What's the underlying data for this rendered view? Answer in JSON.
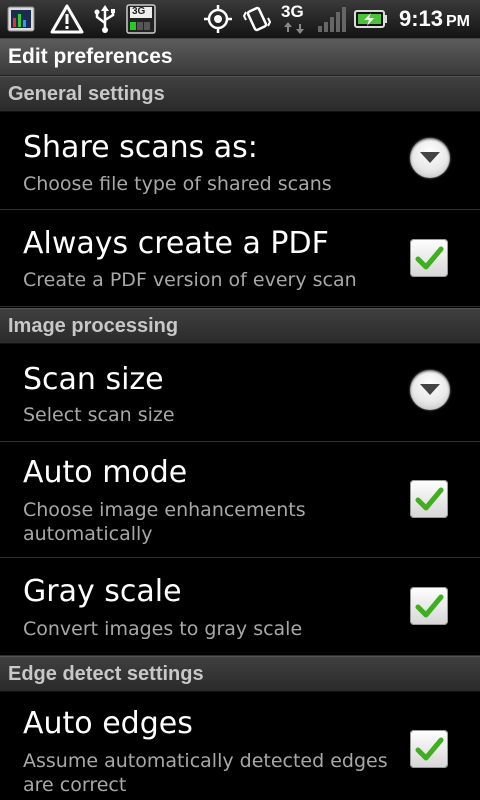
{
  "status_bar": {
    "network_type": "3G",
    "sim_label": "3G",
    "time": "9:13",
    "ampm": "PM",
    "icons": [
      "chart-app-icon",
      "warning-icon",
      "usb-icon",
      "sim-3g-icon",
      "gps-icon",
      "vibrate-icon",
      "network-3g-icon",
      "signal-icon",
      "battery-charging-icon"
    ]
  },
  "title_bar": {
    "title": "Edit preferences"
  },
  "sections": [
    {
      "header": "General settings",
      "items": [
        {
          "title": "Share scans as:",
          "summary": "Choose file type of shared scans",
          "control": "dropdown"
        },
        {
          "title": "Always create a PDF",
          "summary": "Create a PDF version of every scan",
          "control": "checkbox",
          "checked": true
        }
      ]
    },
    {
      "header": "Image processing",
      "items": [
        {
          "title": "Scan size",
          "summary": "Select scan size",
          "control": "dropdown"
        },
        {
          "title": "Auto mode",
          "summary": "Choose image enhancements automatically",
          "control": "checkbox",
          "checked": true
        },
        {
          "title": "Gray scale",
          "summary": "Convert images to gray scale",
          "control": "checkbox",
          "checked": true
        }
      ]
    },
    {
      "header": "Edge detect settings",
      "items": [
        {
          "title": "Auto edges",
          "summary": "Assume automatically detected edges are correct",
          "control": "checkbox",
          "checked": true
        }
      ]
    }
  ],
  "colors": {
    "background": "#000000",
    "checkmark": "#3fae1f",
    "summary_text": "#a8a8a8",
    "section_text": "#c8c8c8"
  }
}
